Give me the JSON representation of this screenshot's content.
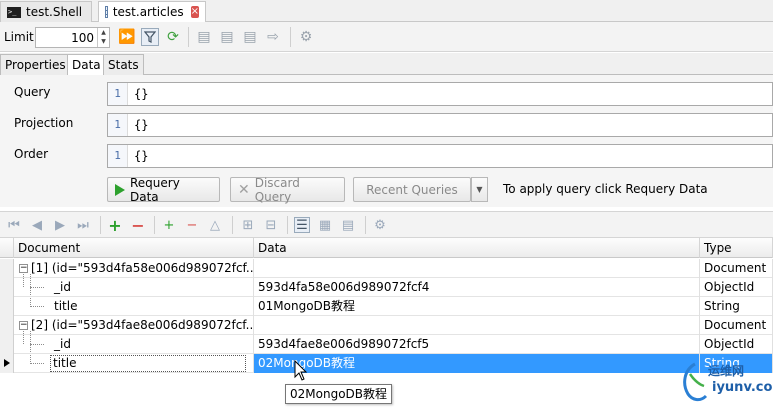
{
  "tabs": [
    {
      "label": "test.Shell",
      "active": false
    },
    {
      "label": "test.articles",
      "active": true
    }
  ],
  "toolbar": {
    "limit_label": "Limit",
    "limit_value": "100"
  },
  "sub_tabs": [
    "Properties",
    "Data",
    "Stats"
  ],
  "query": {
    "query_label": "Query",
    "query_line": "1",
    "query_text": "{}",
    "projection_label": "Projection",
    "projection_line": "1",
    "projection_text": "{}",
    "order_label": "Order",
    "order_line": "1",
    "order_text": "{}",
    "requery_label": "Requery Data",
    "discard_label": "Discard Query",
    "recent_label": "Recent Queries",
    "hint": "To apply query click Requery Data"
  },
  "grid": {
    "columns": [
      "Document",
      "Data",
      "Type"
    ],
    "rows": [
      {
        "doc": "[1] (id=\"593d4fa58e006d989072fcf...",
        "data": "",
        "type": "Document"
      },
      {
        "doc": "_id",
        "data": "593d4fa58e006d989072fcf4",
        "type": "ObjectId"
      },
      {
        "doc": "title",
        "data": "01MongoDB教程",
        "type": "String"
      },
      {
        "doc": "[2] (id=\"593d4fae8e006d989072fcf...",
        "data": "",
        "type": "Document"
      },
      {
        "doc": "_id",
        "data": "593d4fae8e006d989072fcf5",
        "type": "ObjectId"
      },
      {
        "doc": "title",
        "data": "02MongoDB教程",
        "type": "String"
      }
    ],
    "selected_row": 5
  },
  "tooltip": "02MongoDB教程",
  "watermark": {
    "line1": "运维网",
    "line2": "iyunv.com"
  },
  "colors": {
    "selection": "#3399ff",
    "play": "#2da12d",
    "close": "#d9534f"
  }
}
